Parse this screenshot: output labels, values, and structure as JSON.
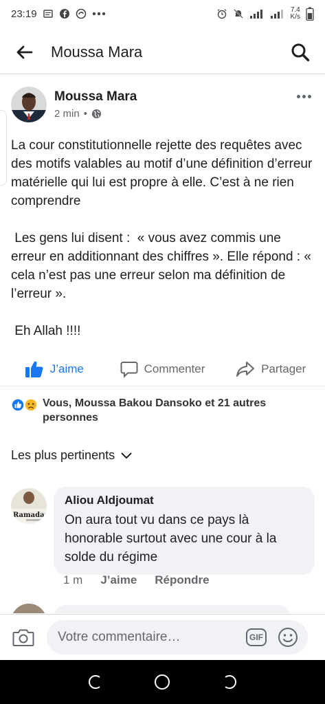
{
  "status_bar": {
    "time": "23:19",
    "net_speed_value": "7.4",
    "net_speed_unit": "K/s"
  },
  "header": {
    "title": "Moussa Mara"
  },
  "post": {
    "author": "Moussa Mara",
    "time": "2 min",
    "separator": "•",
    "privacy_icon": "globe-icon",
    "paragraphs": [
      "La cour constitutionnelle rejette des requêtes avec des motifs valables au motif d’une définition d’erreur matérielle qui lui est propre à elle. C’est à ne rien comprendre",
      " Les gens lui disent :  « vous avez commis une erreur en additionnant des chiffres ». Elle répond : « cela n’est pas une erreur selon ma définition de l’erreur ».",
      " Eh Allah !!!!"
    ]
  },
  "actions": {
    "like": "J’aime",
    "comment": "Commenter",
    "share": "Partager"
  },
  "reactions": {
    "text": "Vous, Moussa Bakou Dansoko et 21 autres personnes"
  },
  "sort": {
    "label": "Les plus pertinents"
  },
  "comments": [
    {
      "author": "Aliou Aldjoumat",
      "text": "On aura tout vu dans ce pays là honorable surtout avec une cour à la solde du régime",
      "time": "1 m",
      "like": "J’aime",
      "reply": "Répondre",
      "avatar_label": "Ramadan"
    }
  ],
  "composer": {
    "placeholder": "Votre commentaire…",
    "gif": "GIF"
  },
  "colors": {
    "accent": "#1877f2",
    "secondary_text": "#65676b",
    "bubble": "#f0f2f5"
  }
}
